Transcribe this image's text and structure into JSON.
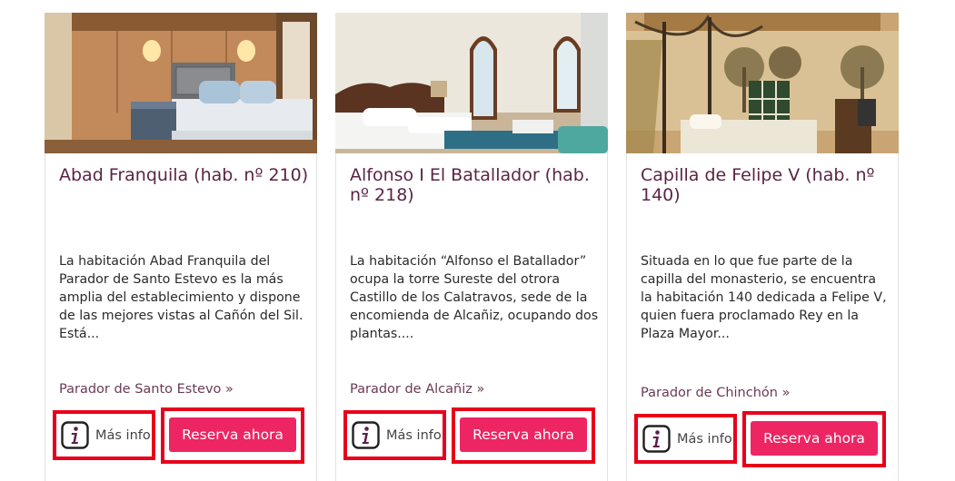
{
  "cards": [
    {
      "title": "Abad Franquila (hab. nº 210)",
      "description": "La habitación Abad Franquila del Parador de Santo Estevo es la más amplia del establecimiento y dispone de las mejores vistas al Cañón del Sil. Está...",
      "parador": "Parador de Santo Estevo »",
      "info_label": "Más info",
      "reserve_label": "Reserva ahora",
      "info_icon": "info-icon"
    },
    {
      "title": "Alfonso I El Batallador (hab. nº 218)",
      "description": "La habitación “Alfonso el Batallador” ocupa la torre Sureste del otrora Castillo de los Calatravos, sede de la encomienda de Alcañiz, ocupando dos plantas....",
      "parador": "Parador de Alcañiz »",
      "info_label": "Más info",
      "reserve_label": "Reserva ahora",
      "info_icon": "info-icon"
    },
    {
      "title": "Capilla de Felipe V (hab. nº 140)",
      "description": "Situada en lo que fue parte de la capilla del monasterio, se encuentra la habitación 140 dedicada a Felipe V, quien fuera proclamado Rey en la Plaza Mayor...",
      "parador": "Parador de Chinchón »",
      "info_label": "Más info",
      "reserve_label": "Reserva ahora",
      "info_icon": "info-icon"
    }
  ],
  "colors": {
    "title": "#5b2446",
    "button": "#ee2563",
    "highlight": "#e8001b"
  }
}
